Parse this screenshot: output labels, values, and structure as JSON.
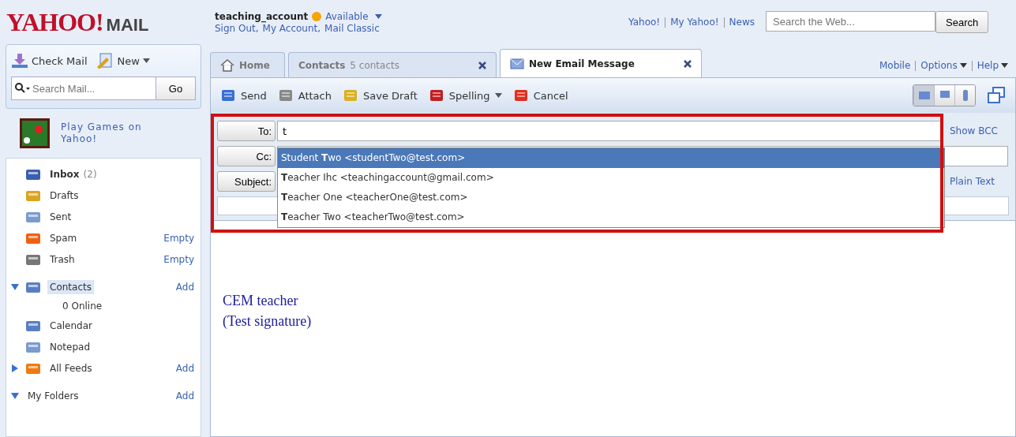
{
  "header": {
    "logo": "YAHOO!",
    "logo_suffix": "MAIL",
    "user": "teaching_account",
    "status": "Available",
    "account_links": [
      "Sign Out,",
      "My Account,",
      "Mail Classic"
    ],
    "top_links": [
      "Yahoo!",
      "My Yahoo!",
      "News"
    ],
    "web_search": {
      "placeholder": "Search the Web..."
    },
    "search_button": "Search"
  },
  "sidebar": {
    "check_mail": "Check Mail",
    "new": "New",
    "search": {
      "placeholder": "Search Mail..."
    },
    "go": "Go",
    "promo": "Play Games on Yahoo!",
    "folders": [
      {
        "kind": "inbox",
        "name": "Inbox",
        "count": "(2)",
        "selected": false
      },
      {
        "kind": "drafts",
        "name": "Drafts",
        "selected": false
      },
      {
        "kind": "sent",
        "name": "Sent",
        "selected": false
      },
      {
        "kind": "spam",
        "name": "Spam",
        "action": "Empty",
        "selected": false
      },
      {
        "kind": "trash",
        "name": "Trash",
        "action": "Empty",
        "selected": false
      },
      {
        "kind": "contacts",
        "name": "Contacts",
        "action": "Add",
        "selected": true,
        "expanded": true,
        "children": [
          {
            "kind": "online",
            "name": "0 Online",
            "selected": false
          }
        ]
      },
      {
        "kind": "calendar",
        "name": "Calendar",
        "selected": false
      },
      {
        "kind": "notepad",
        "name": "Notepad",
        "selected": false
      },
      {
        "kind": "feeds",
        "name": "All Feeds",
        "action": "Add",
        "selected": false,
        "expanded": false
      },
      {
        "kind": "folders",
        "name": "My Folders",
        "action": "Add",
        "selected": false,
        "expanded": true
      }
    ]
  },
  "tabs": [
    {
      "kind": "home",
      "label": "Home",
      "selected": false
    },
    {
      "kind": "contacts",
      "label": "Contacts",
      "detail": "5 contacts",
      "selected": false
    },
    {
      "kind": "message",
      "label": "New Email Message",
      "selected": true
    }
  ],
  "right_links": [
    "Mobile",
    "Options",
    "Help"
  ],
  "toolbar": [
    {
      "kind": "send",
      "label": "Send"
    },
    {
      "kind": "attach",
      "label": "Attach"
    },
    {
      "kind": "save",
      "label": "Save Draft"
    },
    {
      "kind": "spelling",
      "label": "Spelling"
    },
    {
      "kind": "cancel",
      "label": "Cancel"
    }
  ],
  "view_buttons": [
    {
      "kind": "mail",
      "selected": true
    },
    {
      "kind": "chat",
      "selected": false
    },
    {
      "kind": "mobile",
      "selected": false
    }
  ],
  "compose": {
    "to_label": "To:",
    "to_value": "t",
    "cc_label": "Cc:",
    "subject_label": "Subject:",
    "show_bcc": "Show BCC",
    "plain_text": "Plain Text",
    "suggestions": [
      {
        "text": "Student **T**wo <studentTwo@test.com>",
        "selected": true
      },
      {
        "text": "**T**eacher Ihc <teachingaccount@gmail.com>",
        "selected": false
      },
      {
        "text": "**T**eacher One <teacherOne@test.com>",
        "selected": false
      },
      {
        "text": "**T**eacher Two <teacherTwo@test.com>",
        "selected": false
      }
    ],
    "body": [
      "CEM teacher",
      "(Test signature)"
    ]
  }
}
